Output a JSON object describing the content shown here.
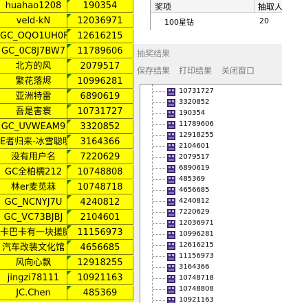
{
  "sheet": {
    "rows": [
      {
        "name": "huahao1208",
        "id": "190354"
      },
      {
        "name": "veld-kN",
        "id": "12036971"
      },
      {
        "name": "GC_OQO1UH0F",
        "id": "12616215"
      },
      {
        "name": "GC_0C8J7BW7",
        "id": "11789606"
      },
      {
        "name": "北方的风",
        "id": "2079517"
      },
      {
        "name": "繁花落烬",
        "id": "10996281"
      },
      {
        "name": "亚洲特雷",
        "id": "6890619"
      },
      {
        "name": "吾是害寰",
        "id": "10731727"
      },
      {
        "name": "GC_UVWEAM9",
        "id": "3320852"
      },
      {
        "name": "E者归来-冰雪聪明",
        "id": "3164366"
      },
      {
        "name": "没有用户名",
        "id": "7220629"
      },
      {
        "name": "GC全柏檽212",
        "id": "10748808"
      },
      {
        "name": "林er麦苋菻",
        "id": "10748718"
      },
      {
        "name": "GC_NCNYJ7U",
        "id": "4240812"
      },
      {
        "name": "GC_VC73BJBJ",
        "id": "2104601"
      },
      {
        "name": "卡巴卡有一块搓脚",
        "id": "11156973"
      },
      {
        "name": "汽车改装文化馆",
        "id": "4656685"
      },
      {
        "name": "风向心飘",
        "id": "12918255"
      },
      {
        "name": "jingzi78111",
        "id": "10921163"
      },
      {
        "name": "JC.Chen",
        "id": "485369"
      }
    ]
  },
  "prize_table": {
    "col_prize": "奖项",
    "col_count": "抽取人",
    "prize": "100星钻",
    "count": "20"
  },
  "dialog": {
    "title": "抽奖结果",
    "save": "保存结果",
    "print": "打印结果",
    "close": "关闭窗口",
    "results": [
      "10731727",
      "3320852",
      "190354",
      "11789606",
      "12918255",
      "2104601",
      "2079517",
      "6890619",
      "485369",
      "4656685",
      "4240812",
      "7220629",
      "12036971",
      "10996281",
      "12616215",
      "11156973",
      "3164366",
      "10748718",
      "10748808",
      "10921163"
    ]
  }
}
